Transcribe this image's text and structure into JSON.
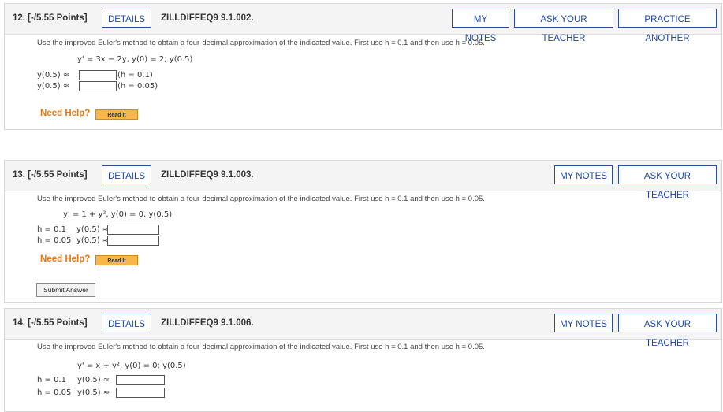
{
  "questions": [
    {
      "number_points": "12. [-/5.55 Points]",
      "details_label": "DETAILS",
      "code": "ZILLDIFFEQ9 9.1.002.",
      "buttons": {
        "notes": "MY NOTES",
        "ask": "ASK YOUR TEACHER",
        "practice": "PRACTICE ANOTHER"
      },
      "instruction": "Use the improved Euler's method to obtain a four-decimal approximation of the indicated value. First use h = 0.1 and then use h = 0.05.",
      "equation": "y' = 3x − 2y,   y(0) = 2;  y(0.5)",
      "rows": [
        {
          "prefix": "y(0.5) ≈",
          "suffix": "(h = 0.1)"
        },
        {
          "prefix": "y(0.5) ≈",
          "suffix": "(h = 0.05)"
        }
      ],
      "need_help": "Need Help?",
      "read_it": "Read It"
    },
    {
      "number_points": "13. [-/5.55 Points]",
      "details_label": "DETAILS",
      "code": "ZILLDIFFEQ9 9.1.003.",
      "buttons": {
        "notes": "MY NOTES",
        "ask": "ASK YOUR TEACHER"
      },
      "instruction": "Use the improved Euler's method to obtain a four-decimal approximation of the indicated value. First use h = 0.1 and then use h = 0.05.",
      "equation": "y' = 1 + y², y(0) = 0;  y(0.5)",
      "rows": [
        {
          "h": "h = 0.1",
          "prefix": "y(0.5) ≈"
        },
        {
          "h": "h = 0.05",
          "prefix": "y(0.5) ≈"
        }
      ],
      "need_help": "Need Help?",
      "read_it": "Read It",
      "submit": "Submit Answer"
    },
    {
      "number_points": "14. [-/5.55 Points]",
      "details_label": "DETAILS",
      "code": "ZILLDIFFEQ9 9.1.006.",
      "buttons": {
        "notes": "MY NOTES",
        "ask": "ASK YOUR TEACHER"
      },
      "instruction": "Use the improved Euler's method to obtain a four-decimal approximation of the indicated value. First use h = 0.1 and then use h = 0.05.",
      "equation": "y' = x + y², y(0) = 0;  y(0.5)",
      "rows": [
        {
          "h": "h = 0.1",
          "prefix": "y(0.5) ≈"
        },
        {
          "h": "h = 0.05",
          "prefix": "y(0.5) ≈"
        }
      ]
    }
  ],
  "colors": {
    "button_border": "#2a4e9b",
    "button_text": "#1f4aa3",
    "need_help": "#e87511",
    "read_it_bg": "#f7b64a",
    "header_bg": "#f4f4f4"
  }
}
